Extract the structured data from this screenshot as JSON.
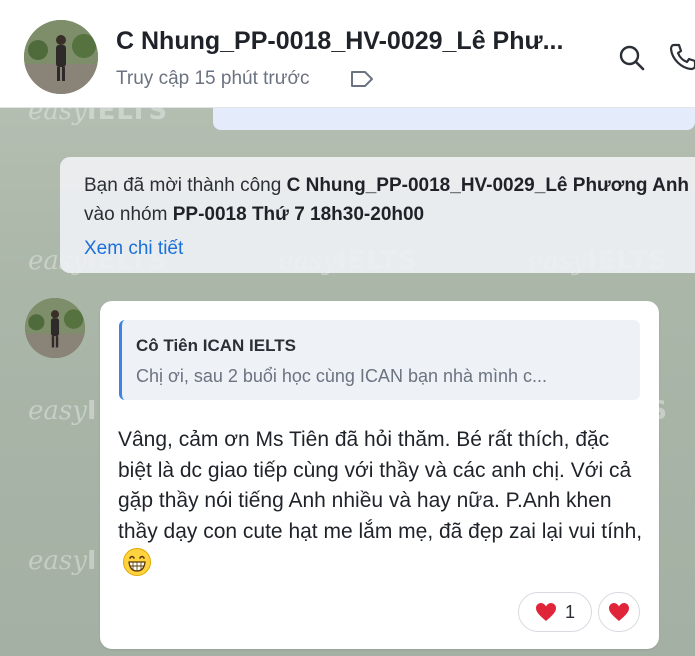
{
  "header": {
    "title": "C Nhung_PP-0018_HV-0029_Lê Phư...",
    "status": "Truy cập 15 phút trước"
  },
  "watermark": {
    "brand_script": "easy",
    "brand_bold": "IELTS"
  },
  "notice": {
    "prefix": "Bạn đã mời thành công ",
    "invitee": "C Nhung_PP-0018_HV-0029_Lê Phương Anh",
    "middle": "vào nhóm ",
    "group": "PP-0018 Thứ 7 18h30-20h00",
    "link": "Xem chi tiết"
  },
  "message": {
    "quote_author": "Cô Tiên ICAN IELTS",
    "quote_text": "Chị ơi, sau 2 buổi học cùng ICAN bạn nhà mình c...",
    "text": "Vâng, cảm ơn Ms Tiên đã hỏi thăm. Bé rất thích, đặc biệt là dc giao tiếp cùng với thầy và các anh chị. Với cả gặp thầy nói tiếng Anh nhiều và hay nữa. P.Anh khen thầy dạy con cute hạt me lắm mẹ, đã đẹp zai lại vui tính,",
    "reaction_count": "1"
  },
  "colors": {
    "accent": "#1a6fd9",
    "quote_bar": "#3c84e6",
    "heart": "#e0243a"
  },
  "icons": {
    "tag": "tag-icon",
    "search": "search-icon",
    "call": "phone-icon",
    "emoji": "grinning-face-emoji",
    "reaction": "heart-icon"
  }
}
